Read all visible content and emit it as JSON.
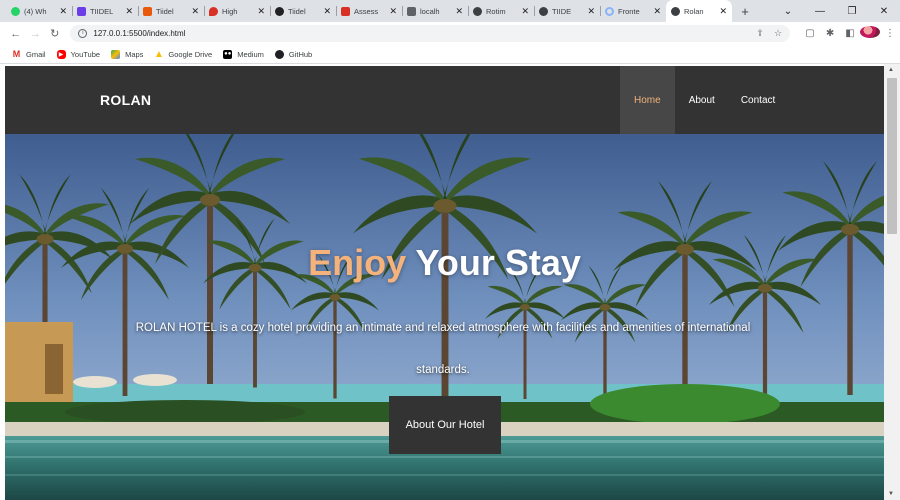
{
  "browser": {
    "tabs": [
      {
        "label": "(4) Wh",
        "icon": "whatsapp-icon",
        "color": "#25d366"
      },
      {
        "label": "TIIDEL",
        "icon": "purple-square-icon",
        "color": "#6a3de8"
      },
      {
        "label": "Tiidel",
        "icon": "orange-icon",
        "color": "#e8590c"
      },
      {
        "label": "High",
        "icon": "pin-icon",
        "color": "#d93025"
      },
      {
        "label": "Tiidel",
        "icon": "github-icon",
        "color": "#202124"
      },
      {
        "label": "Assess",
        "icon": "gmail-icon",
        "color": "#d93025"
      },
      {
        "label": "localh",
        "icon": "page-icon",
        "color": "#5f6368"
      },
      {
        "label": "Rotim",
        "icon": "globe-icon",
        "color": "#3c4043"
      },
      {
        "label": "TIIDE",
        "icon": "globe-icon",
        "color": "#3c4043"
      },
      {
        "label": "Fronte",
        "icon": "loading-icon",
        "color": "#8ab4f8"
      },
      {
        "label": "Rolan",
        "icon": "globe-icon",
        "color": "#3c4043",
        "active": true
      }
    ],
    "new_tab": "+",
    "url": "127.0.0.1:5500/index.html",
    "bookmarks": [
      {
        "label": "Gmail",
        "icon": "gmail-icon",
        "color": "#d93025"
      },
      {
        "label": "YouTube",
        "icon": "youtube-icon",
        "color": "#ff0000"
      },
      {
        "label": "Maps",
        "icon": "maps-icon",
        "color": "#34a853"
      },
      {
        "label": "Google Drive",
        "icon": "drive-icon",
        "color": "#fbbc04"
      },
      {
        "label": "Medium",
        "icon": "medium-icon",
        "color": "#000000"
      },
      {
        "label": "GitHub",
        "icon": "github-icon",
        "color": "#202124"
      }
    ]
  },
  "site": {
    "brand": "ROLAN",
    "nav": [
      "Home",
      "About",
      "Contact"
    ],
    "hero": {
      "title_accent": "Enjoy",
      "title_rest": " Your Stay",
      "text": "ROLAN HOTEL is a cozy hotel providing an intimate and relaxed atmosphere with facilities and amenities of international standards.",
      "button": "About Our Hotel"
    }
  },
  "colors": {
    "nav_bg": "#333333",
    "accent": "#f5b27b"
  }
}
